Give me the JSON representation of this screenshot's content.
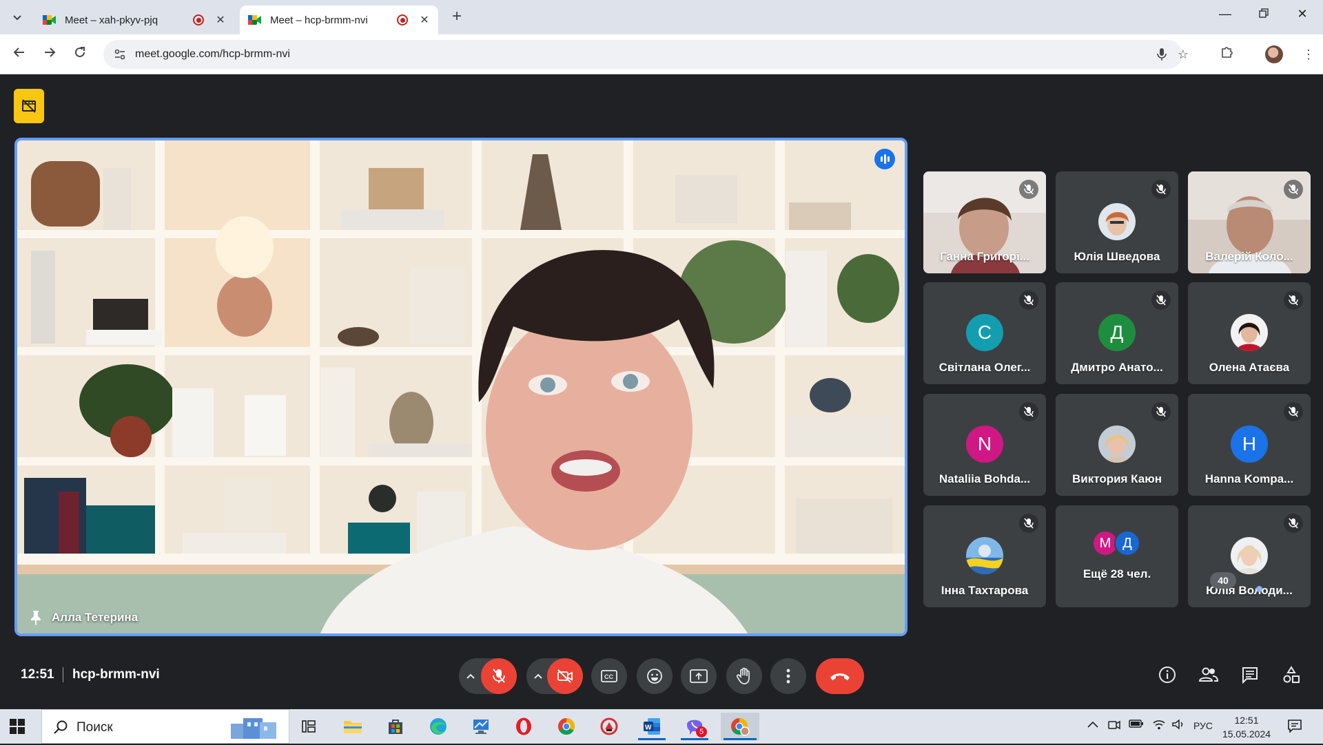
{
  "browser": {
    "tabs": [
      {
        "title": "Meet – xah-pkyv-pjq",
        "active": false,
        "favicon": "google-meet-icon",
        "recording": true
      },
      {
        "title": "Meet – hcp-brmm-nvi",
        "active": true,
        "favicon": "google-meet-icon",
        "recording": true
      }
    ],
    "url": "meet.google.com/hcp-brmm-nvi"
  },
  "meet": {
    "main_speaker": {
      "name": "Алла Тетерина",
      "pinned": true,
      "speaking": true
    },
    "participants": [
      {
        "name": "Ганна Григорі...",
        "type": "video",
        "muted": true
      },
      {
        "name": "Юлія Шведова",
        "type": "photo",
        "muted": true
      },
      {
        "name": "Валерій Коло...",
        "type": "video",
        "muted": true
      },
      {
        "name": "Світлана Олег...",
        "type": "initial",
        "initial": "С",
        "color": "#129eaf",
        "muted": true
      },
      {
        "name": "Дмитро Анато...",
        "type": "initial",
        "initial": "Д",
        "color": "#1e8e3e",
        "muted": true
      },
      {
        "name": "Олена Атаєва",
        "type": "photo",
        "muted": true
      },
      {
        "name": "Nataliia Bohda...",
        "type": "initial",
        "initial": "N",
        "color": "#d01884",
        "muted": true
      },
      {
        "name": "Виктория Каюн",
        "type": "photo",
        "muted": true
      },
      {
        "name": "Hanna Kompa...",
        "type": "initial",
        "initial": "H",
        "color": "#1a73e8",
        "muted": true
      },
      {
        "name": "Інна Тахтарова",
        "type": "photo",
        "muted": true
      },
      {
        "name": "Ещё 28 чел.",
        "type": "more",
        "initials": [
          "М",
          "Д"
        ],
        "colors": [
          "#d01884",
          "#1967d2"
        ],
        "muted": false
      },
      {
        "name": "Юлія Володи...",
        "type": "photo",
        "muted": true
      }
    ],
    "time": "12:51",
    "meeting_code": "hcp-brmm-nvi",
    "people_count": "40",
    "colors": {
      "accent": "#669df6",
      "danger": "#ea4335",
      "surface": "#3c4043",
      "background": "#202124"
    }
  },
  "taskbar": {
    "search_placeholder": "Поиск",
    "language": "РУС",
    "clock_time": "12:51",
    "clock_date": "15.05.2024",
    "viber_badge": "5"
  }
}
